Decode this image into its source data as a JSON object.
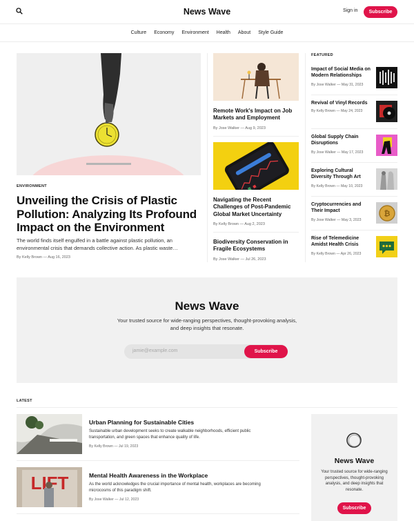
{
  "header": {
    "site_name": "News Wave",
    "signin": "Sign in",
    "subscribe": "Subscribe"
  },
  "nav": [
    "Culture",
    "Economy",
    "Environment",
    "Health",
    "About",
    "Style Guide"
  ],
  "hero": {
    "tag": "ENVIRONMENT",
    "title": "Unveiling the Crisis of Plastic Pollution: Analyzing Its Profound Impact on the Environment",
    "excerpt": "The world finds itself engulfed in a battle against plastic pollution, an environmental crisis that demands collective action. As plastic waste…",
    "meta": "By Kelly Brown — Aug 16, 2023"
  },
  "middle": [
    {
      "title": "Remote Work's Impact on Job Markets and Employment",
      "meta": "By Jose Walker — Aug 9, 2023"
    },
    {
      "title": "Navigating the Recent Challenges of Post-Pandemic Global Market Uncertainty",
      "meta": "By Kelly Brown — Aug 2, 2023"
    },
    {
      "title": "Biodiversity Conservation in Fragile Ecosystems",
      "meta": "By Jose Walker — Jul 26, 2023"
    }
  ],
  "featured": {
    "heading": "FEATURED",
    "items": [
      {
        "title": "Impact of Social Media on Modern Relationships",
        "meta": "By Jose Walker — May 31, 2023"
      },
      {
        "title": "Revival of Vinyl Records",
        "meta": "By Kelly Brown — May 24, 2023"
      },
      {
        "title": "Global Supply Chain Disruptions",
        "meta": "By Jose Walker — May 17, 2023"
      },
      {
        "title": "Exploring Cultural Diversity Through Art",
        "meta": "By Kelly Brown — May 10, 2023"
      },
      {
        "title": "Cryptocurrencies and Their Impact",
        "meta": "By Jose Walker — May 3, 2023"
      },
      {
        "title": "Rise of Telemedicine Amidst Health Crisis",
        "meta": "By Kelly Brown — Apr 26, 2023"
      }
    ]
  },
  "newsletter": {
    "title": "News Wave",
    "subtitle": "Your trusted source for wide-ranging perspectives, thought-provoking analysis, and deep insights that resonate.",
    "placeholder": "jamie@example.com",
    "button": "Subscribe"
  },
  "latest": {
    "heading": "LATEST",
    "items": [
      {
        "title": "Urban Planning for Sustainable Cities",
        "desc": "Sustainable urban development seeks to create walkable neighborhoods, efficient public transportation, and green spaces that enhance quality of life.",
        "meta": "By Kelly Brown — Jul 19, 2023"
      },
      {
        "title": "Mental Health Awareness in the Workplace",
        "desc": "As the world acknowledges the crucial importance of mental health, workplaces are becoming microcosms of this paradigm shift.",
        "meta": "By Jose Walker — Jul 12, 2023",
        "image_text": "LIFT"
      }
    ]
  },
  "sidebar_card": {
    "title": "News Wave",
    "subtitle": "Your trusted source for wide-ranging perspectives, thought-provoking analysis, and deep insights that resonate.",
    "button": "Subscribe"
  },
  "colors": {
    "accent": "#e0144a",
    "panel": "#f1f1f1"
  }
}
